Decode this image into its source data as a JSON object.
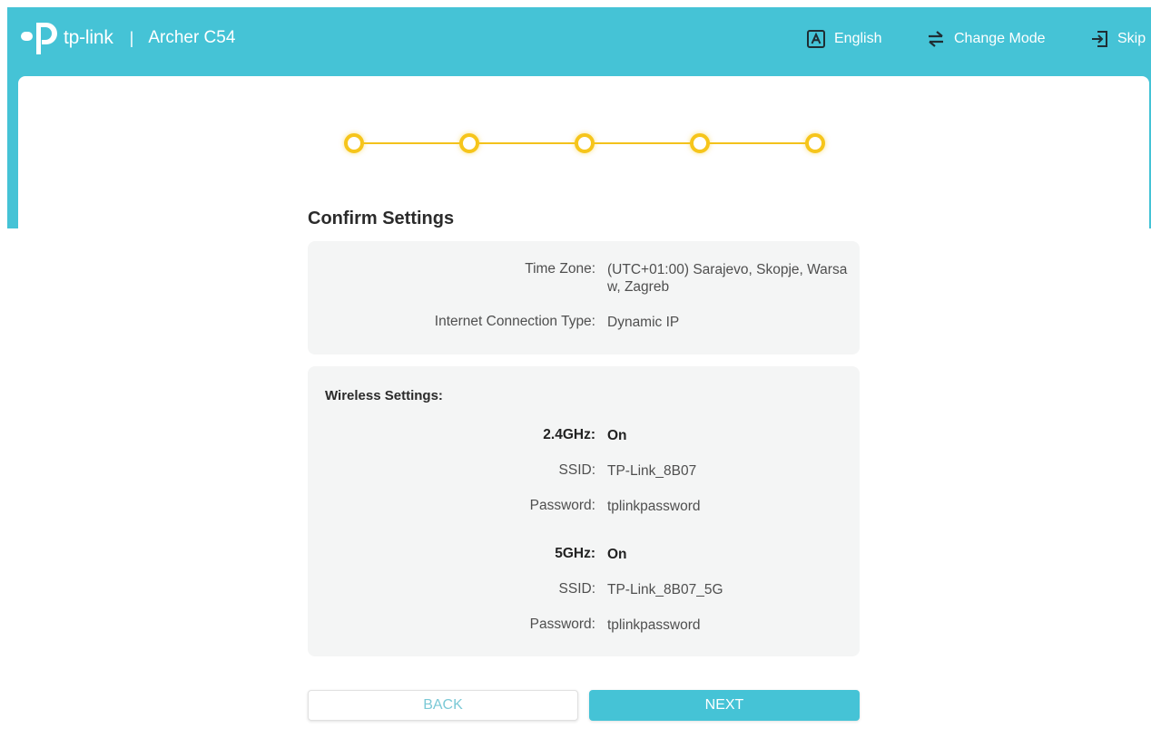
{
  "header": {
    "brand": "tp-link",
    "separator": "|",
    "model": "Archer C54",
    "language": "English",
    "change_mode": "Change Mode",
    "skip": "Skip"
  },
  "wizard": {
    "total_steps": 5,
    "completed_steps": 5,
    "step_color": "#f6c51b"
  },
  "confirm": {
    "title": "Confirm Settings",
    "time_zone_label": "Time Zone:",
    "time_zone_value": "(UTC+01:00) Sarajevo, Skopje, Warsaw, Zagreb",
    "connection_label": "Internet Connection Type:",
    "connection_value": "Dynamic IP"
  },
  "wireless": {
    "section_label": "Wireless Settings:",
    "band_24": {
      "label": "2.4GHz:",
      "status": "On",
      "ssid_label": "SSID:",
      "ssid": "TP-Link_8B07",
      "password_label": "Password:",
      "password": "tplinkpassword"
    },
    "band_5": {
      "label": "5GHz:",
      "status": "On",
      "ssid_label": "SSID:",
      "ssid": "TP-Link_8B07_5G",
      "password_label": "Password:",
      "password": "tplinkpassword"
    }
  },
  "buttons": {
    "back": "BACK",
    "next": "NEXT"
  },
  "colors": {
    "primary": "#45c3d6",
    "step": "#f6c51b",
    "panel_bg": "#f4f5f5"
  }
}
